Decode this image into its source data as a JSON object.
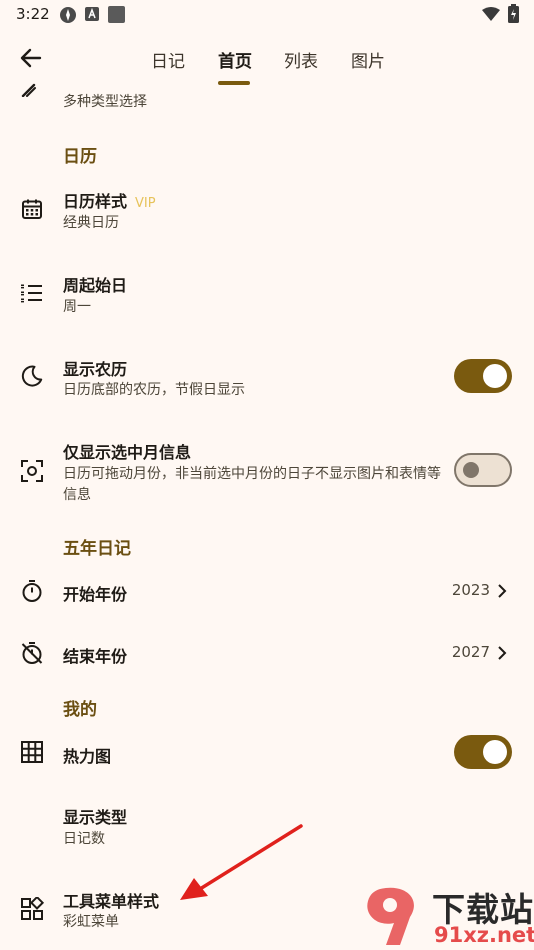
{
  "status_bar": {
    "time": "3:22",
    "icons": [
      "system-settings-icon",
      "a-badge-icon",
      "square-icon",
      "wifi-icon",
      "battery-icon"
    ]
  },
  "app_bar": {
    "back_icon": "arrow-left-icon",
    "tabs": [
      {
        "label": "日记",
        "active": false
      },
      {
        "label": "首页",
        "active": true
      },
      {
        "label": "列表",
        "active": false
      },
      {
        "label": "图片",
        "active": false
      }
    ]
  },
  "settings": {
    "partial_row": {
      "icon": "pen-icon",
      "subtitle": "多种类型选择"
    },
    "calendar_section": {
      "header": "日历",
      "calendar_style": {
        "icon": "calendar-icon",
        "title": "日历样式",
        "badge": "VIP",
        "subtitle": "经典日历"
      },
      "week_start": {
        "icon": "list-icon",
        "title": "周起始日",
        "subtitle": "周一"
      },
      "lunar": {
        "icon": "moon-icon",
        "title": "显示农历",
        "subtitle": "日历底部的农历，节假日显示",
        "enabled": true
      },
      "only_month": {
        "icon": "focus-icon",
        "title": "仅显示选中月信息",
        "subtitle": "日历可拖动月份，非当前选中月份的日子不显示图片和表情等信息",
        "enabled": false
      }
    },
    "five_year_section": {
      "header": "五年日记",
      "start_year": {
        "icon": "timer-icon",
        "title": "开始年份",
        "value": "2023"
      },
      "end_year": {
        "icon": "timer-off-icon",
        "title": "结束年份",
        "value": "2027"
      }
    },
    "mine_section": {
      "header": "我的",
      "heatmap": {
        "icon": "grid-icon",
        "title": "热力图",
        "enabled": true
      },
      "display_type": {
        "title": "显示类型",
        "subtitle": "日记数"
      },
      "toolbar_style": {
        "icon": "widgets-icon",
        "title": "工具菜单样式",
        "subtitle": "彩虹菜单"
      }
    }
  },
  "annotation": {
    "arrow_color": "#e0211c"
  },
  "watermark": {
    "text": "下载站",
    "url": "91xz.net"
  },
  "colors": {
    "accent": "#7a5a0f",
    "background": "#fff8f3",
    "vip": "#e7c35b"
  }
}
